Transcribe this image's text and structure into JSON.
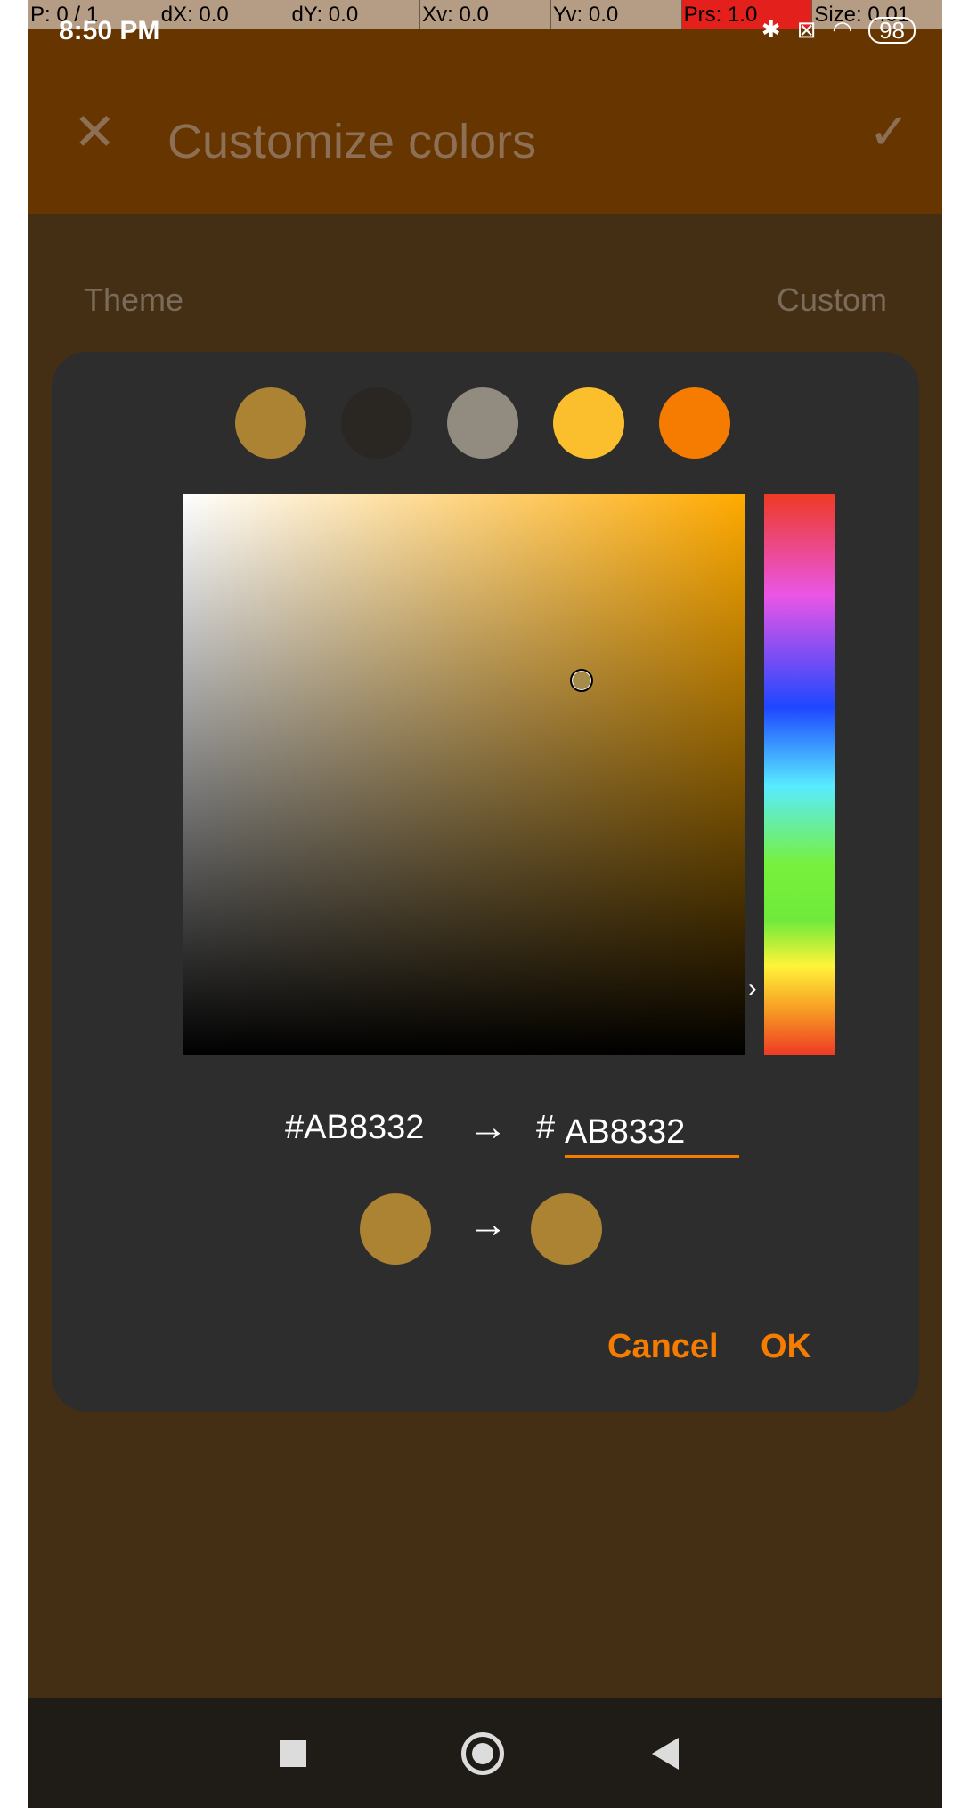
{
  "debug_bar": [
    "P: 0 / 1",
    "dX: 0.0",
    "dY: 0.0",
    "Xv: 0.0",
    "Yv: 0.0",
    "Prs: 1.0",
    "Size: 0.01"
  ],
  "status": {
    "time": "8:50 PM",
    "battery": "98"
  },
  "appbar": {
    "title": "Customize colors"
  },
  "theme": {
    "label": "Theme",
    "value": "Custom"
  },
  "dialog": {
    "swatches": [
      "#ab8332",
      "#2a2722",
      "#928b80",
      "#fbbe2d",
      "#f57c00"
    ],
    "hex_old": "#AB8332",
    "hex_hash": "#",
    "hex_new": "AB8332",
    "color_old": "#ab8332",
    "color_new": "#ab8332",
    "cancel_label": "Cancel",
    "ok_label": "OK"
  },
  "colors": {
    "accent": "#f57c00",
    "appbar": "#663500",
    "background": "#442f15",
    "dialog": "#2d2d2d"
  }
}
